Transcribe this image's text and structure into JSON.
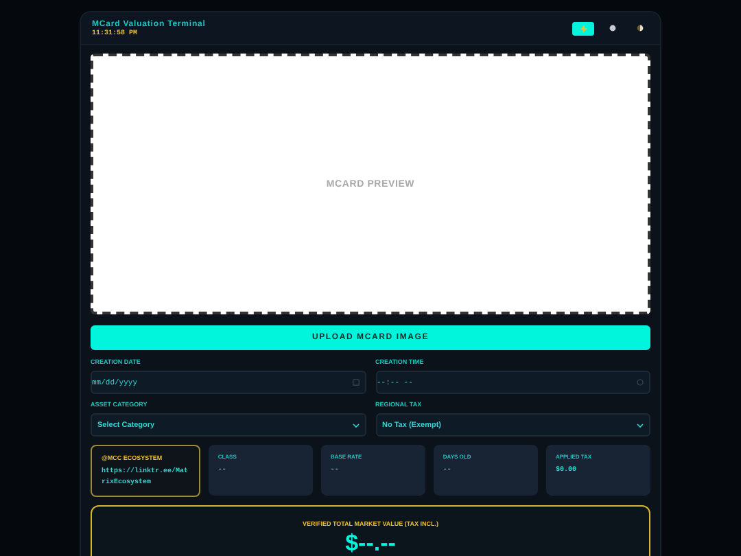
{
  "header": {
    "title": "MCard Valuation Terminal",
    "time": "11:31:58 PM",
    "buttons": [
      {
        "kind": "bolt",
        "selected": true
      },
      {
        "kind": "circle",
        "selected": false
      },
      {
        "kind": "contrast",
        "selected": false
      }
    ]
  },
  "preview": {
    "label": "MCARD PREVIEW"
  },
  "upload_button": "UPLOAD MCARD IMAGE",
  "fields": [
    {
      "label": "CREATION DATE",
      "kind": "date",
      "placeholder": "mm/dd/yyyy"
    },
    {
      "label": "CREATION TIME",
      "kind": "time",
      "placeholder": "--:-- --"
    },
    {
      "label": "ASSET CATEGORY",
      "kind": "select",
      "value": "Select Category"
    },
    {
      "label": "REGIONAL TAX",
      "kind": "select",
      "value": "No Tax (Exempt)"
    }
  ],
  "ecosystem": {
    "title": "@MCC ECOSYSTEM",
    "link": "https://linktr.ee/MatrixEcosystem"
  },
  "stats": [
    {
      "label": "CLASS",
      "value": "--"
    },
    {
      "label": "BASE RATE",
      "value": "--"
    },
    {
      "label": "DAYS OLD",
      "value": "--"
    },
    {
      "label": "APPLIED TAX",
      "value": "$0.00"
    }
  ],
  "total": {
    "label": "VERIFIED TOTAL MARKET VALUE (TAX INCL.)",
    "value": "$--.--"
  }
}
